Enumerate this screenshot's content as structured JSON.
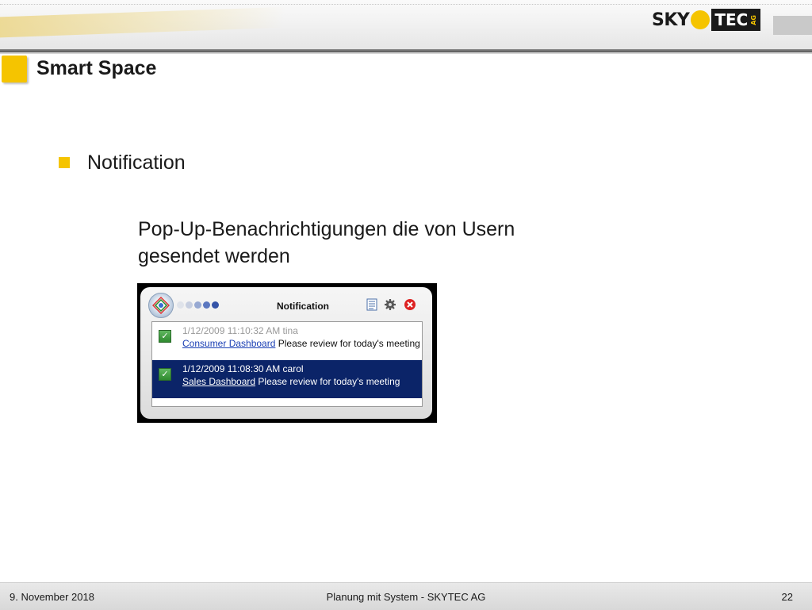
{
  "header": {
    "logo": {
      "text_left": "SKY",
      "text_right": "TEC",
      "suffix": "AG"
    },
    "brand_colors": {
      "yellow": "#f5c400",
      "dark": "#1a1a1a"
    }
  },
  "slide": {
    "title": "Smart Space",
    "bullet": "Notification",
    "description_line1": "Pop-Up-Benachrichtigungen die von Usern",
    "description_line2": "gesendet werden"
  },
  "notification_window": {
    "title": "Notification",
    "icons": [
      "app-logo-icon",
      "notes-icon",
      "settings-gear-icon",
      "close-icon"
    ],
    "items": [
      {
        "timestamp_user": "1/12/2009 11:10:32 AM tina",
        "link": "Consumer Dashboard",
        "message": " Please review for today's meeting",
        "checked": true,
        "selected": false
      },
      {
        "timestamp_user": "1/12/2009 11:08:30 AM carol",
        "link": "Sales Dashboard",
        "message": " Please review for today's meeting",
        "checked": true,
        "selected": true
      }
    ]
  },
  "footer": {
    "date": "9. November 2018",
    "center": "Planung mit System - SKYTEC AG",
    "page": "22"
  }
}
